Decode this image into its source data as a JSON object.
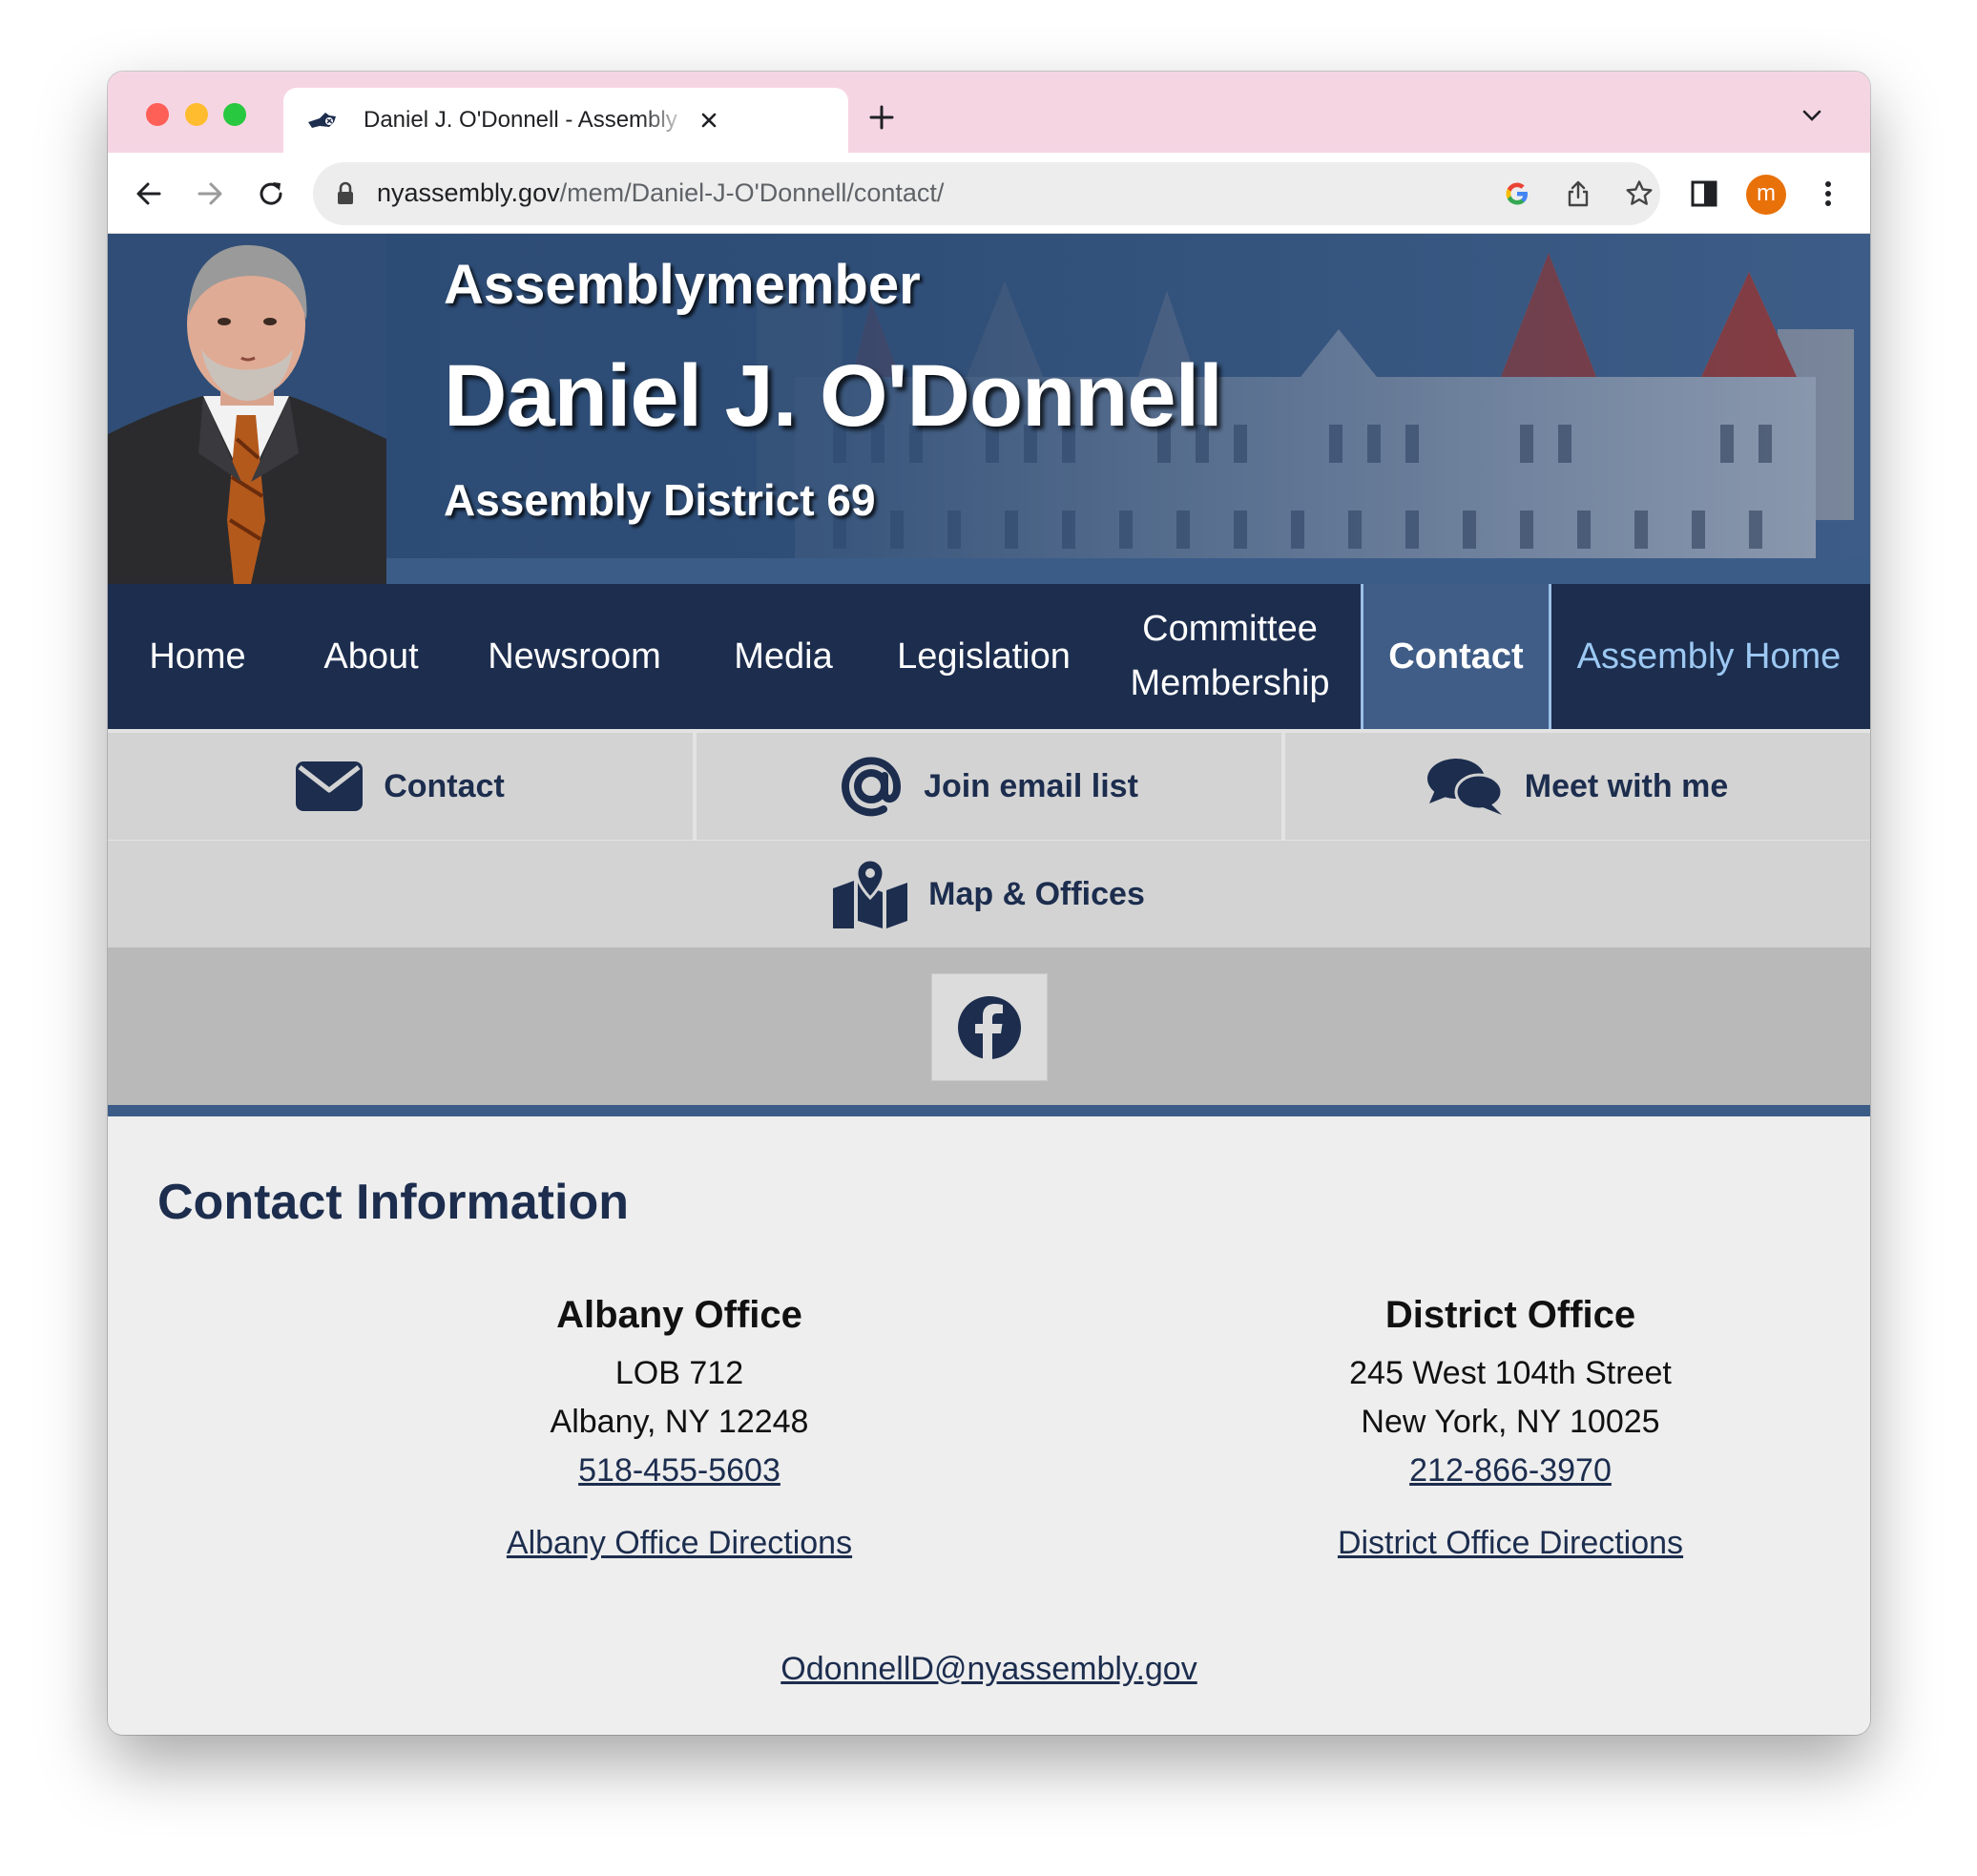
{
  "browser": {
    "tab_title": "Daniel J. O'Donnell - Assembly",
    "url_host": "nyassembly.gov",
    "url_path": "/mem/Daniel-J-O'Donnell/contact/",
    "profile_initial": "m"
  },
  "banner": {
    "title": "Assemblymember",
    "name": "Daniel J. O'Donnell",
    "district": "Assembly District 69"
  },
  "nav": {
    "home": "Home",
    "about": "About",
    "newsroom": "Newsroom",
    "media": "Media",
    "legislation": "Legislation",
    "committee_line1": "Committee",
    "committee_line2": "Membership",
    "contact": "Contact",
    "assembly_home": "Assembly Home",
    "active": "Contact"
  },
  "subnav": {
    "contact": "Contact",
    "join_email": "Join email list",
    "meet": "Meet with me",
    "map_offices": "Map & Offices"
  },
  "social": {
    "facebook_icon": "facebook-icon"
  },
  "contact": {
    "heading": "Contact Information",
    "albany": {
      "name": "Albany Office",
      "line1": "LOB 712",
      "line2": "Albany, NY 12248",
      "phone": "518-455-5603",
      "directions": "Albany Office Directions"
    },
    "district": {
      "name": "District Office",
      "line1": "245 West 104th Street",
      "line2": "New York, NY 10025",
      "phone": "212-866-3970",
      "directions": "District Office Directions"
    },
    "email": "OdonnellD@nyassembly.gov"
  },
  "colors": {
    "tab_bar": "#f6d5e3",
    "navy": "#1c2d4e",
    "active_nav": "#3f5d87",
    "assembly_home_link": "#9cc8f2",
    "profile_avatar": "#e8710a"
  }
}
